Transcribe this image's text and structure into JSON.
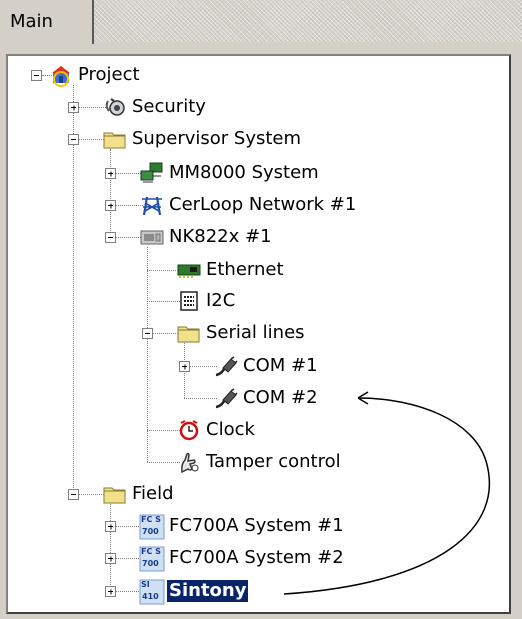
{
  "tab": {
    "label": "Main"
  },
  "tree": [
    {
      "id": "project",
      "label": "Project",
      "icon": "project-icon",
      "expander": "minus"
    },
    {
      "id": "security",
      "label": "Security",
      "icon": "security-icon",
      "expander": "plus"
    },
    {
      "id": "supervisor-system",
      "label": "Supervisor System",
      "icon": "folder-icon",
      "expander": "minus"
    },
    {
      "id": "mm8000-system",
      "label": "MM8000 System",
      "icon": "computers-network-icon",
      "expander": "plus"
    },
    {
      "id": "cerloop-network-1",
      "label": "CerLoop Network #1",
      "icon": "network-tower-icon",
      "expander": "plus"
    },
    {
      "id": "nk822x-1",
      "label": "NK822x #1",
      "icon": "device-module-icon",
      "expander": "minus"
    },
    {
      "id": "ethernet",
      "label": "Ethernet",
      "icon": "network-card-icon",
      "expander": "none"
    },
    {
      "id": "i2c",
      "label": "I2C",
      "icon": "bus-connector-icon",
      "expander": "none"
    },
    {
      "id": "serial-lines",
      "label": "Serial lines",
      "icon": "folder-icon",
      "expander": "minus"
    },
    {
      "id": "com-1",
      "label": "COM #1",
      "icon": "cable-plug-icon",
      "expander": "plus"
    },
    {
      "id": "com-2",
      "label": "COM #2",
      "icon": "cable-plug-icon",
      "expander": "none"
    },
    {
      "id": "clock",
      "label": "Clock",
      "icon": "alarm-clock-icon",
      "expander": "none"
    },
    {
      "id": "tamper-control",
      "label": "Tamper control",
      "icon": "tamper-hand-icon",
      "expander": "none"
    },
    {
      "id": "field",
      "label": "Field",
      "icon": "folder-icon",
      "expander": "minus"
    },
    {
      "id": "fc700a-system-1",
      "label": "FC700A System #1",
      "icon": "fc-700-badge-icon",
      "expander": "plus",
      "badge": [
        "FC S",
        "700"
      ]
    },
    {
      "id": "fc700a-system-2",
      "label": "FC700A System #2",
      "icon": "fc-700-badge-icon",
      "expander": "plus",
      "badge": [
        "FC S",
        "700"
      ]
    },
    {
      "id": "sintony",
      "label": "Sintony",
      "icon": "si-410-badge-icon",
      "expander": "plus",
      "badge": [
        "SI",
        "410"
      ],
      "selected": true
    }
  ],
  "colors": {
    "selection": "#0a246a",
    "folder": "#f3e08a",
    "badge": "#cfe0f5"
  }
}
